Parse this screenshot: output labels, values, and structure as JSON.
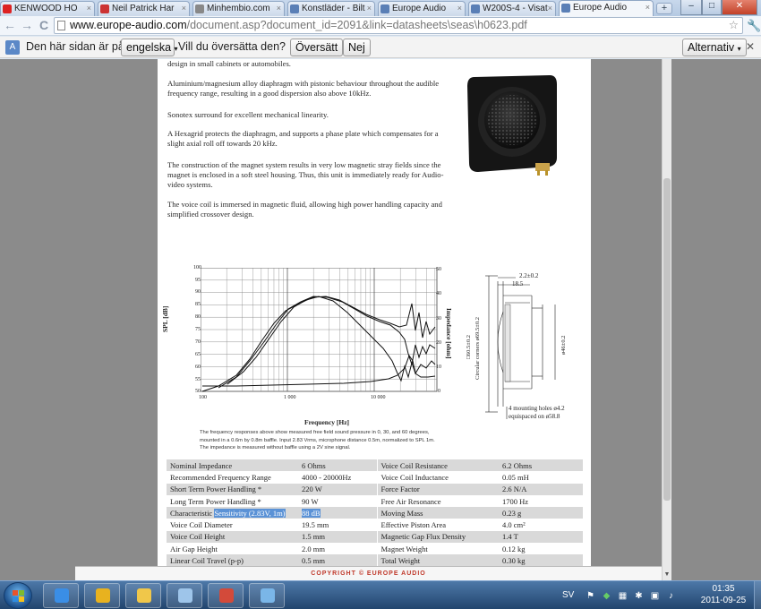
{
  "browser": {
    "tabs": [
      {
        "label": "KENWOOD HO",
        "color": "#d22"
      },
      {
        "label": "Neil Patrick Har",
        "color": "#c33"
      },
      {
        "label": "Minhembio.com",
        "color": "#888"
      },
      {
        "label": "Konstläder - Bilt",
        "color": "#5a7fb6"
      },
      {
        "label": "Europe Audio",
        "color": "#5a7fb6"
      },
      {
        "label": "W200S-4 - Visat",
        "color": "#5a7fb6"
      },
      {
        "label": "Europe Audio",
        "color": "#5a7fb6"
      }
    ],
    "close_glyph": "×",
    "new_tab_glyph": "+",
    "window_controls": {
      "minimize": "–",
      "maximize": "□",
      "close": "✕"
    },
    "back_glyph": "←",
    "forward_glyph": "→",
    "reload_glyph": "C",
    "url_host": "www.europe-audio.com",
    "url_path": "/document.asp?document_id=2091&link=datasheets\\seas\\h0623.pdf",
    "star_glyph": "☆",
    "wrench_glyph": "🔧"
  },
  "translate_bar": {
    "text": "Den här sidan är på",
    "language": "engelska",
    "question": "Vill du översätta den?",
    "translate_button": "Översätt",
    "no_button": "Nej",
    "options_button": "Alternativ"
  },
  "document": {
    "first_line": "design in small cabinets or automobiles.",
    "paragraphs": [
      "Aluminium/magnesium alloy diaphragm with pistonic behaviour throughout the audible frequency range, resulting in a good dispersion also above 10kHz.",
      "Sonotex surround for excellent mechanical linearity.",
      "A Hexagrid protects the diaphragm, and supports a phase plate which compensates for a slight axial roll off towards 20 kHz.",
      "The construction of the magnet system results in very low magnetic stray fields since the magnet is enclosed in a soft steel housing. Thus, this unit is immediately ready for Audio-video systems.",
      "The voice coil is immersed in magnetic fluid, allowing high power handling capacity and simplified crossover design."
    ],
    "chart_ylabel": "SPL [dB]",
    "chart_y2label": "Impedance [ohm]",
    "chart_xlabel": "Frequency [Hz]",
    "chart_y_ticks": [
      "100",
      "95",
      "90",
      "85",
      "80",
      "75",
      "70",
      "65",
      "60",
      "55",
      "50"
    ],
    "chart_y2_ticks": [
      "50",
      "40",
      "30",
      "20",
      "10",
      "0"
    ],
    "chart_x_ticks": [
      "100",
      "1 000",
      "10 000"
    ],
    "caption": "The frequency responses above show measured free field sound pressure in 0, 30, and 60 degrees, mounted in a 0.6m by 0.8m baffle. Input 2.83 Vrms, microphone distance 0.5m, normalized to SPL 1m. The impedance is measured without baffle using a 2V sine signal.",
    "drawing_labels": {
      "top1": "2.2±0.2",
      "top2": "18.5",
      "left_dim": "□60.5±0.2",
      "left_dim2": "Circular corners ø69.5±0.2",
      "right_dim": "ø46±0.2",
      "holes": "4 mounting holes ø4.2",
      "holes2": "equispaced on ø58.8"
    },
    "specs": [
      [
        "Nominal Impedance",
        "6 Ohms",
        "Voice Coil Resistance",
        "6.2 Ohms"
      ],
      [
        "Recommended Frequency Range",
        "4000 - 20000Hz",
        "Voice Coil Inductance",
        "0.05 mH"
      ],
      [
        "Short Term Power Handling *",
        "220 W",
        "Force Factor",
        "2.6 N/A"
      ],
      [
        "Long Term Power Handling *",
        "90 W",
        "Free Air Resonance",
        "1700 Hz"
      ],
      [
        "Characteristic Sensitivity (2.83V, 1m)",
        "88 dB",
        "Moving Mass",
        "0.23 g"
      ],
      [
        "Voice Coil Diameter",
        "19.5 mm",
        "Effective Piston Area",
        "4.0 cm²"
      ],
      [
        "Voice Coil Height",
        "1.5 mm",
        "Magnetic Gap Flux Density",
        "1.4 T"
      ],
      [
        "Air Gap Height",
        "2.0 mm",
        "Magnet Weight",
        "0.12 kg"
      ],
      [
        "Linear Coil Travel (p-p)",
        "0.5 mm",
        "Total Weight",
        "0.30 kg"
      ]
    ],
    "spec_highlight": {
      "prefix": "Characteristic ",
      "selected": "Sensitivity (2.83V, 1m)",
      "value": "88 dB"
    },
    "footer": "COPYRIGHT © EUROPE AUDIO"
  },
  "taskbar": {
    "apps": [
      {
        "name": "itunes-icon",
        "color": "#3a8ee6"
      },
      {
        "name": "chrome-icon",
        "color": "#e8b21f"
      },
      {
        "name": "explorer-folder-icon",
        "color": "#f0c74a"
      },
      {
        "name": "network-icon",
        "color": "#9ec5ea"
      },
      {
        "name": "volume-icon",
        "color": "#d34a3a"
      },
      {
        "name": "paint-icon",
        "color": "#7ab6e8"
      }
    ],
    "language": "SV",
    "time": "01:35",
    "date": "2011-09-25"
  }
}
